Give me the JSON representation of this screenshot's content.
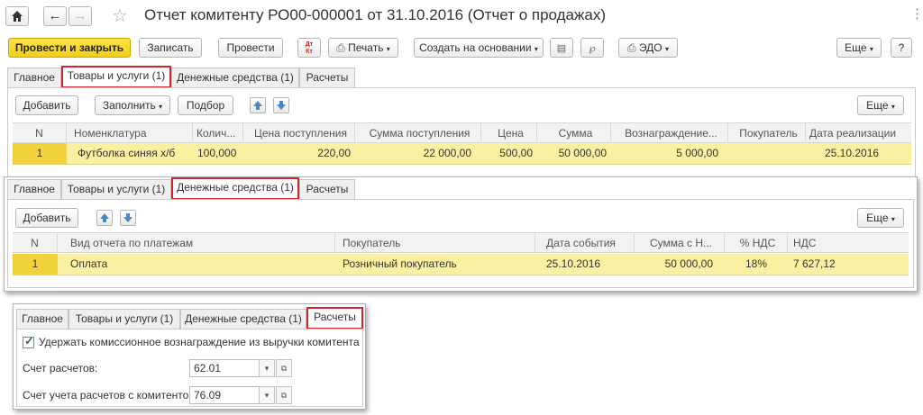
{
  "window": {
    "title": "Отчет комитенту РО00-000001 от 31.10.2016 (Отчет о продажах)",
    "more_glyph": "⋮"
  },
  "toolbar": {
    "post_close": "Провести и закрыть",
    "save": "Записать",
    "post": "Провести",
    "dtkt": "Дт Кт",
    "print": "Печать",
    "create_based": "Создать на основании",
    "edo": "ЭДО",
    "more": "Еще",
    "help": "?"
  },
  "tabs": [
    "Главное",
    "Товары и услуги (1)",
    "Денежные средства (1)",
    "Расчеты"
  ],
  "goods": {
    "add": "Добавить",
    "fill": "Заполнить",
    "select": "Подбор",
    "more": "Еще",
    "columns": [
      "N",
      "Номенклатура",
      "Колич...",
      "Цена поступления",
      "Сумма поступления",
      "Цена",
      "Сумма",
      "Вознаграждение...",
      "Покупатель",
      "Дата реализации"
    ],
    "row": [
      "1",
      "Футболка синяя х/б",
      "100,000",
      "220,00",
      "22 000,00",
      "500,00",
      "50 000,00",
      "5 000,00",
      "",
      "25.10.2016"
    ]
  },
  "money": {
    "add": "Добавить",
    "more": "Еще",
    "columns": [
      "N",
      "Вид отчета по платежам",
      "Покупатель",
      "Дата события",
      "Сумма с Н...",
      "% НДС",
      "НДС"
    ],
    "row": [
      "1",
      "Оплата",
      "Розничный покупатель",
      "25.10.2016",
      "50 000,00",
      "18%",
      "7 627,12"
    ]
  },
  "settlements": {
    "checkbox_label": "Удержать комиссионное вознаграждение из выручки комитента",
    "checked": true,
    "account_label": "Счет расчетов:",
    "account_value": "62.01",
    "committent_label": "Счет учета расчетов с комитентом:",
    "committent_value": "76.09"
  }
}
